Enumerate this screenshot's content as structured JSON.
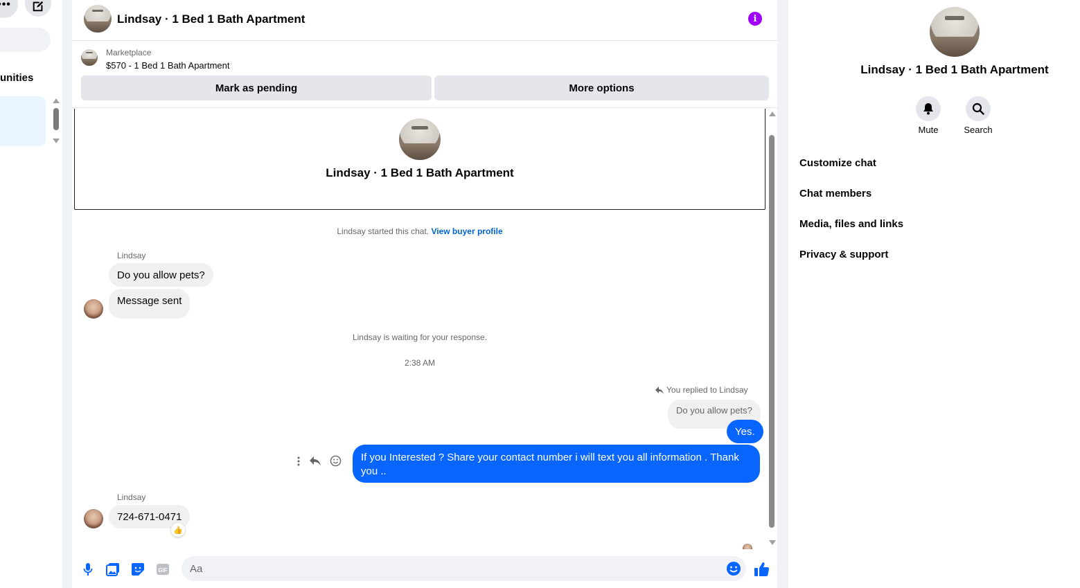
{
  "sidebar": {
    "more_glyph": "•••",
    "communities_label": "unities"
  },
  "header": {
    "title": "Lindsay · 1 Bed 1 Bath Apartment",
    "info_glyph": "i",
    "accent_color": "#a100ff"
  },
  "marketplace": {
    "label": "Marketplace",
    "listing": "$570 - 1 Bed 1 Bath Apartment",
    "mark_pending_label": "Mark as pending",
    "more_options_label": "More options"
  },
  "intro": {
    "title": "Lindsay · 1 Bed 1 Bath Apartment"
  },
  "conversation": {
    "started_text": "Lindsay started this chat.",
    "view_profile_link": "View buyer profile",
    "sender_name_1": "Lindsay",
    "msg_1": "Do you allow pets?",
    "msg_2": "Message sent",
    "waiting_text": "Lindsay is waiting for your response.",
    "timestamp": "2:38 AM",
    "reply_note": "You replied to Lindsay",
    "quoted_text": "Do you allow pets?",
    "out_msg_1": "Yes.",
    "out_msg_2": "If you Interested ?  Share your contact number i will text you all information  . Thank you ..",
    "sender_name_2": "Lindsay",
    "msg_3": "724-671-0471",
    "reaction": "👍",
    "bubble_out_color": "#0866ff"
  },
  "composer": {
    "placeholder": "Aa",
    "gif_label": "GIF",
    "icon_color": "#0866ff"
  },
  "details": {
    "title": "Lindsay · 1 Bed 1 Bath Apartment",
    "mute_label": "Mute",
    "search_label": "Search",
    "menu": [
      {
        "label": "Customize chat"
      },
      {
        "label": "Chat members"
      },
      {
        "label": "Media, files and links"
      },
      {
        "label": "Privacy & support"
      }
    ]
  }
}
